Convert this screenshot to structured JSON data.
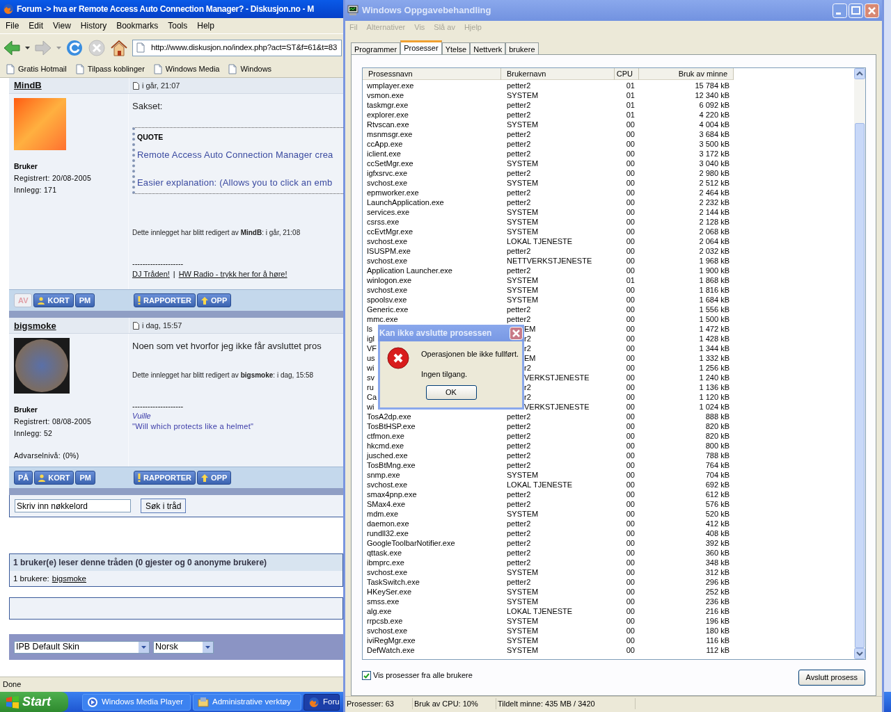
{
  "browser": {
    "title": "Forum -> hva er Remote Access Auto Connection Manager? - Diskusjon.no - M",
    "menu": [
      "File",
      "Edit",
      "View",
      "History",
      "Bookmarks",
      "Tools",
      "Help"
    ],
    "address": "http://www.diskusjon.no/index.php?act=ST&f=61&t=83",
    "bookmarks": [
      "Gratis Hotmail",
      "Tilpass koblinger",
      "Windows Media",
      "Windows"
    ],
    "posts": [
      {
        "author": "MindB",
        "time": "i går, 21:07",
        "rank": "Bruker",
        "registered": "Registrert: 20/08-2005",
        "count": "Innlegg: 171",
        "body": [
          {
            "kind": "lead",
            "text": "Sakset:"
          },
          {
            "kind": "quote",
            "label": "QUOTE",
            "lines": [
              "Remote Access Auto Connection Manager crea",
              "Easier explanation: (Allows you to click an emb"
            ]
          },
          {
            "kind": "edited",
            "text": "Dette innlegget har blitt redigert av **MindB**: i går, 21:08"
          },
          {
            "kind": "rule",
            "text": "--------------------"
          },
          {
            "kind": "links",
            "items": [
              "DJ Tråden!",
              "HW Radio - trykk her for å høre!"
            ],
            "separator": "|"
          }
        ],
        "left_buttons": [
          {
            "label": "AV",
            "disabled": true
          },
          {
            "label": "KORT",
            "disabled": false
          },
          {
            "label": "PM",
            "disabled": false
          }
        ],
        "right_buttons": [
          {
            "label": "RAPPORTER"
          },
          {
            "label": "OPP"
          }
        ]
      },
      {
        "author": "bigsmoke",
        "time": "i dag, 15:57",
        "rank": "Bruker",
        "registered": "Registrert: 08/08-2005",
        "count": "Innlegg: 52",
        "warning": "Advarselnivå: (0%)",
        "body": [
          {
            "kind": "lead",
            "text": "Noen som vet hvorfor jeg ikke får avsluttet pros"
          },
          {
            "kind": "edited",
            "text": "Dette innlegget har blitt redigert av **bigsmoke**: i dag, 15:58"
          },
          {
            "kind": "rule",
            "text": "--------------------"
          },
          {
            "kind": "sig_name",
            "text": "Vuille"
          },
          {
            "kind": "sig_text",
            "text": "\"Will which protects like a helmet\""
          }
        ],
        "left_buttons": [
          {
            "label": "PÅ",
            "disabled": false
          },
          {
            "label": "KORT",
            "disabled": false
          },
          {
            "label": "PM",
            "disabled": false
          }
        ],
        "right_buttons": [
          {
            "label": "RAPPORTER"
          },
          {
            "label": "OPP"
          }
        ]
      }
    ],
    "search": {
      "value": "Skriv inn nøkkelord",
      "button": "Søk i tråd"
    },
    "readers": {
      "title": "1 bruker(e) leser denne tråden (0 gjester og 0 anonyme brukere)",
      "label": "1 brukere:",
      "user": "bigsmoke"
    },
    "selects": [
      "IPB Default Skin",
      "Norsk"
    ],
    "status": "Done"
  },
  "taskbar": {
    "start": "Start",
    "items": [
      {
        "label": "Windows Media Player",
        "selected": false
      },
      {
        "label": "Administrative verktøy",
        "selected": false
      },
      {
        "label": "Foru",
        "selected": true
      }
    ]
  },
  "task_manager": {
    "title": "Windows Oppgavebehandling",
    "menu": [
      "Fil",
      "Alternativer",
      "Vis",
      "Slå av",
      "Hjelp"
    ],
    "tabs": [
      {
        "label": "Programmer",
        "selected": false
      },
      {
        "label": "Prosesser",
        "selected": true
      },
      {
        "label": "Ytelse",
        "selected": false
      },
      {
        "label": "Nettverk",
        "selected": false
      },
      {
        "label": "brukere",
        "selected": false
      }
    ],
    "columns": [
      "Prosessnavn",
      "Brukernavn",
      "CPU",
      "Bruk av minne"
    ],
    "rows": [
      {
        "name": "wmplayer.exe",
        "user": "petter2",
        "cpu": "01",
        "mem": "15 784 kB"
      },
      {
        "name": "vsmon.exe",
        "user": "SYSTEM",
        "cpu": "01",
        "mem": "12 340 kB"
      },
      {
        "name": "taskmgr.exe",
        "user": "petter2",
        "cpu": "01",
        "mem": "6 092 kB"
      },
      {
        "name": "explorer.exe",
        "user": "petter2",
        "cpu": "01",
        "mem": "4 220 kB"
      },
      {
        "name": "Rtvscan.exe",
        "user": "SYSTEM",
        "cpu": "00",
        "mem": "4 004 kB"
      },
      {
        "name": "msnmsgr.exe",
        "user": "petter2",
        "cpu": "00",
        "mem": "3 684 kB"
      },
      {
        "name": "ccApp.exe",
        "user": "petter2",
        "cpu": "00",
        "mem": "3 500 kB"
      },
      {
        "name": "iclient.exe",
        "user": "petter2",
        "cpu": "00",
        "mem": "3 172 kB"
      },
      {
        "name": "ccSetMgr.exe",
        "user": "SYSTEM",
        "cpu": "00",
        "mem": "3 040 kB"
      },
      {
        "name": "igfxsrvc.exe",
        "user": "petter2",
        "cpu": "00",
        "mem": "2 980 kB"
      },
      {
        "name": "svchost.exe",
        "user": "SYSTEM",
        "cpu": "00",
        "mem": "2 512 kB"
      },
      {
        "name": "epmworker.exe",
        "user": "petter2",
        "cpu": "00",
        "mem": "2 464 kB"
      },
      {
        "name": "LaunchApplication.exe",
        "user": "petter2",
        "cpu": "00",
        "mem": "2 232 kB"
      },
      {
        "name": "services.exe",
        "user": "SYSTEM",
        "cpu": "00",
        "mem": "2 144 kB"
      },
      {
        "name": "csrss.exe",
        "user": "SYSTEM",
        "cpu": "00",
        "mem": "2 128 kB"
      },
      {
        "name": "ccEvtMgr.exe",
        "user": "SYSTEM",
        "cpu": "00",
        "mem": "2 068 kB"
      },
      {
        "name": "svchost.exe",
        "user": "LOKAL TJENESTE",
        "cpu": "00",
        "mem": "2 064 kB"
      },
      {
        "name": "ISUSPM.exe",
        "user": "petter2",
        "cpu": "00",
        "mem": "2 032 kB"
      },
      {
        "name": "svchost.exe",
        "user": "NETTVERKSTJENESTE",
        "cpu": "00",
        "mem": "1 968 kB"
      },
      {
        "name": "Application Launcher.exe",
        "user": "petter2",
        "cpu": "00",
        "mem": "1 900 kB"
      },
      {
        "name": "winlogon.exe",
        "user": "SYSTEM",
        "cpu": "01",
        "mem": "1 868 kB"
      },
      {
        "name": "svchost.exe",
        "user": "SYSTEM",
        "cpu": "00",
        "mem": "1 816 kB"
      },
      {
        "name": "spoolsv.exe",
        "user": "SYSTEM",
        "cpu": "00",
        "mem": "1 684 kB"
      },
      {
        "name": "Generic.exe",
        "user": "petter2",
        "cpu": "00",
        "mem": "1 556 kB"
      },
      {
        "name": "mmc.exe",
        "user": "petter2",
        "cpu": "00",
        "mem": "1 500 kB"
      },
      {
        "name": "ls",
        "user": "EM",
        "cpu": "00",
        "mem": "1 472 kB",
        "covered": true
      },
      {
        "name": "igl",
        "user": "r2",
        "cpu": "00",
        "mem": "1 428 kB",
        "covered": true
      },
      {
        "name": "VF",
        "user": "r2",
        "cpu": "00",
        "mem": "1 344 kB",
        "covered": true
      },
      {
        "name": "us",
        "user": "EM",
        "cpu": "00",
        "mem": "1 332 kB",
        "covered": true
      },
      {
        "name": "wi",
        "user": "r2",
        "cpu": "00",
        "mem": "1 256 kB",
        "covered": true
      },
      {
        "name": "sv",
        "user": "VERKSTJENESTE",
        "cpu": "00",
        "mem": "1 240 kB",
        "covered": true
      },
      {
        "name": "ru",
        "user": "r2",
        "cpu": "00",
        "mem": "1 136 kB",
        "covered": true
      },
      {
        "name": "Ca",
        "user": "r2",
        "cpu": "00",
        "mem": "1 120 kB",
        "covered": true
      },
      {
        "name": "wi",
        "user": "VERKSTJENESTE",
        "cpu": "00",
        "mem": "1 024 kB",
        "covered": true
      },
      {
        "name": "TosA2dp.exe",
        "user": "petter2",
        "cpu": "00",
        "mem": "888 kB"
      },
      {
        "name": "TosBtHSP.exe",
        "user": "petter2",
        "cpu": "00",
        "mem": "820 kB"
      },
      {
        "name": "ctfmon.exe",
        "user": "petter2",
        "cpu": "00",
        "mem": "820 kB"
      },
      {
        "name": "hkcmd.exe",
        "user": "petter2",
        "cpu": "00",
        "mem": "800 kB"
      },
      {
        "name": "jusched.exe",
        "user": "petter2",
        "cpu": "00",
        "mem": "788 kB"
      },
      {
        "name": "TosBtMng.exe",
        "user": "petter2",
        "cpu": "00",
        "mem": "764 kB"
      },
      {
        "name": "snmp.exe",
        "user": "SYSTEM",
        "cpu": "00",
        "mem": "704 kB"
      },
      {
        "name": "svchost.exe",
        "user": "LOKAL TJENESTE",
        "cpu": "00",
        "mem": "692 kB"
      },
      {
        "name": "smax4pnp.exe",
        "user": "petter2",
        "cpu": "00",
        "mem": "612 kB"
      },
      {
        "name": "SMax4.exe",
        "user": "petter2",
        "cpu": "00",
        "mem": "576 kB"
      },
      {
        "name": "mdm.exe",
        "user": "SYSTEM",
        "cpu": "00",
        "mem": "520 kB"
      },
      {
        "name": "daemon.exe",
        "user": "petter2",
        "cpu": "00",
        "mem": "412 kB"
      },
      {
        "name": "rundll32.exe",
        "user": "petter2",
        "cpu": "00",
        "mem": "408 kB"
      },
      {
        "name": "GoogleToolbarNotifier.exe",
        "user": "petter2",
        "cpu": "00",
        "mem": "392 kB"
      },
      {
        "name": "qttask.exe",
        "user": "petter2",
        "cpu": "00",
        "mem": "360 kB"
      },
      {
        "name": "ibmprc.exe",
        "user": "petter2",
        "cpu": "00",
        "mem": "348 kB"
      },
      {
        "name": "svchost.exe",
        "user": "SYSTEM",
        "cpu": "00",
        "mem": "312 kB"
      },
      {
        "name": "TaskSwitch.exe",
        "user": "petter2",
        "cpu": "00",
        "mem": "296 kB"
      },
      {
        "name": "HKeySer.exe",
        "user": "SYSTEM",
        "cpu": "00",
        "mem": "252 kB"
      },
      {
        "name": "smss.exe",
        "user": "SYSTEM",
        "cpu": "00",
        "mem": "236 kB"
      },
      {
        "name": "alg.exe",
        "user": "LOKAL TJENESTE",
        "cpu": "00",
        "mem": "216 kB"
      },
      {
        "name": "rrpcsb.exe",
        "user": "SYSTEM",
        "cpu": "00",
        "mem": "196 kB"
      },
      {
        "name": "svchost.exe",
        "user": "SYSTEM",
        "cpu": "00",
        "mem": "180 kB"
      },
      {
        "name": "iviRegMgr.exe",
        "user": "SYSTEM",
        "cpu": "00",
        "mem": "116 kB"
      },
      {
        "name": "DefWatch.exe",
        "user": "SYSTEM",
        "cpu": "00",
        "mem": "112 kB"
      }
    ],
    "show_all": {
      "label": "Vis prosesser fra alle brukere",
      "checked": true
    },
    "end_button": "Avslutt prosess",
    "status": [
      "Prosesser: 63",
      "Bruk av CPU: 10%",
      "Tildelt minne: 435 MB / 3420"
    ]
  },
  "dialog": {
    "title": "Kan ikke avslutte prosessen",
    "lines": [
      "Operasjonen ble ikke fullført.",
      "Ingen tilgang."
    ],
    "button": "OK"
  }
}
